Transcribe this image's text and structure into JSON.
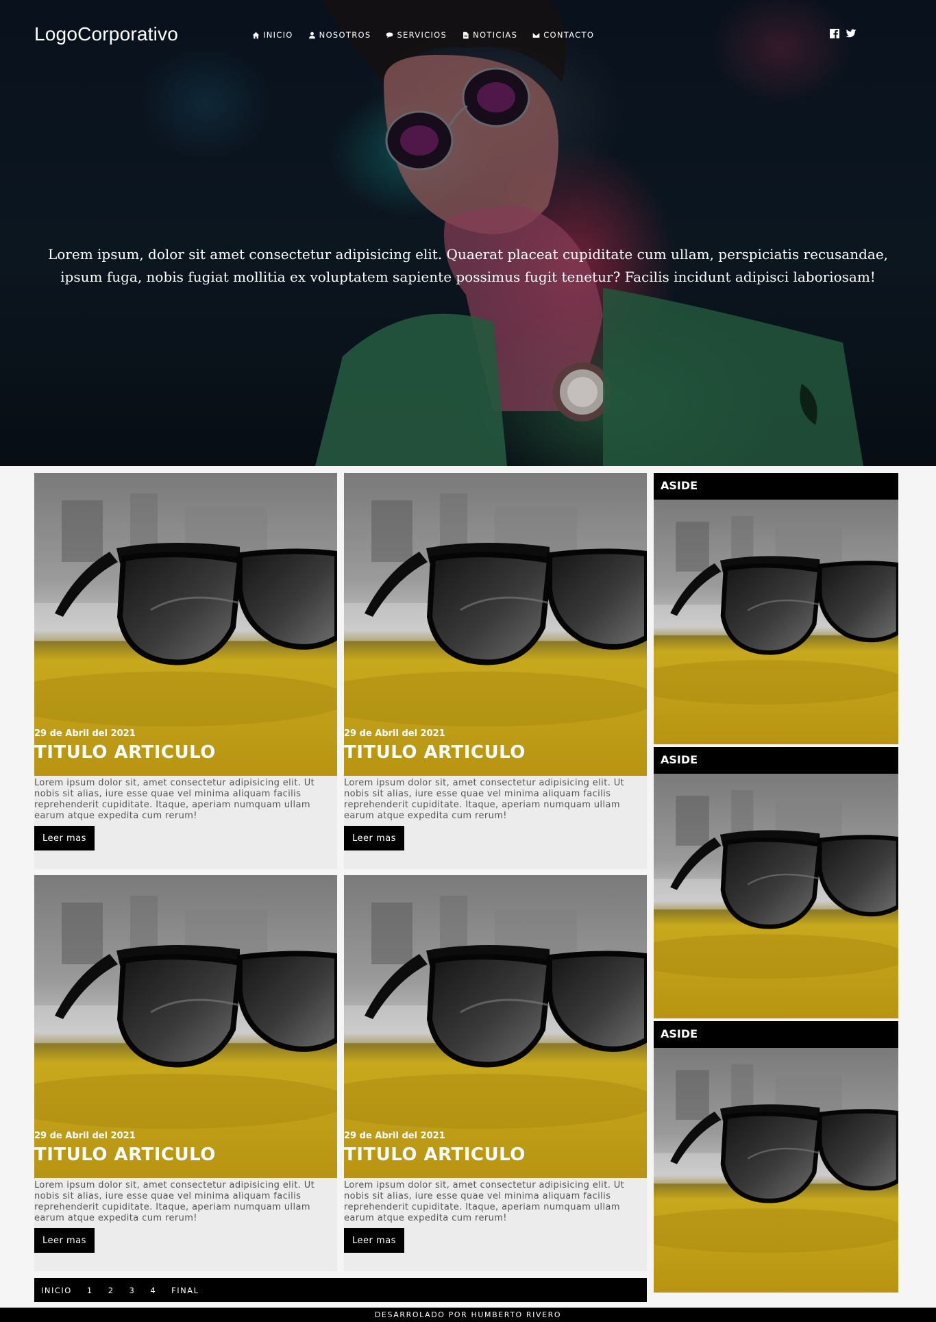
{
  "header": {
    "logo": "LogoCorporativo",
    "nav": [
      {
        "label": "INICIO",
        "icon": "home-icon"
      },
      {
        "label": "NOSOTROS",
        "icon": "user-icon"
      },
      {
        "label": "SERVICIOS",
        "icon": "chat-icon"
      },
      {
        "label": "NOTICIAS",
        "icon": "file-icon"
      },
      {
        "label": "CONTACTO",
        "icon": "envelope-icon"
      }
    ],
    "social": [
      "facebook-icon",
      "twitter-icon"
    ]
  },
  "hero": {
    "text": "Lorem ipsum, dolor sit amet consectetur adipisicing elit. Quaerat placeat cupiditate cum ullam, perspiciatis recusandae, ipsum fuga, nobis fugiat mollitia ex voluptatem sapiente possimus fugit tenetur? Facilis incidunt adipisci laboriosam!"
  },
  "articles": [
    {
      "date": "29 de Abril del 2021",
      "title": "TITULO ARTICULO",
      "excerpt": "Lorem ipsum dolor sit, amet consectetur adipisicing elit. Ut nobis sit alias, iure esse quae vel minima aliquam facilis reprehenderit cupiditate. Itaque, aperiam numquam ullam earum atque expedita cum rerum!",
      "button": "Leer mas"
    },
    {
      "date": "29 de Abril del 2021",
      "title": "TITULO ARTICULO",
      "excerpt": "Lorem ipsum dolor sit, amet consectetur adipisicing elit. Ut nobis sit alias, iure esse quae vel minima aliquam facilis reprehenderit cupiditate. Itaque, aperiam numquam ullam earum atque expedita cum rerum!",
      "button": "Leer mas"
    },
    {
      "date": "29 de Abril del 2021",
      "title": "TITULO ARTICULO",
      "excerpt": "Lorem ipsum dolor sit, amet consectetur adipisicing elit. Ut nobis sit alias, iure esse quae vel minima aliquam facilis reprehenderit cupiditate. Itaque, aperiam numquam ullam earum atque expedita cum rerum!",
      "button": "Leer mas"
    },
    {
      "date": "29 de Abril del 2021",
      "title": "TITULO ARTICULO",
      "excerpt": "Lorem ipsum dolor sit, amet consectetur adipisicing elit. Ut nobis sit alias, iure esse quae vel minima aliquam facilis reprehenderit cupiditate. Itaque, aperiam numquam ullam earum atque expedita cum rerum!",
      "button": "Leer mas"
    }
  ],
  "aside": [
    {
      "label": "ASIDE"
    },
    {
      "label": "ASIDE"
    },
    {
      "label": "ASIDE"
    }
  ],
  "pagination": [
    "INICIO",
    "1",
    "2",
    "3",
    "4",
    "FINAL"
  ],
  "footer": {
    "text": "DESARROLADO POR HUMBERTO RIVERO"
  },
  "colors": {
    "accent": "#000000",
    "card_bg": "#ececec",
    "page_bg": "#f5f5f5",
    "text": "#555555"
  }
}
